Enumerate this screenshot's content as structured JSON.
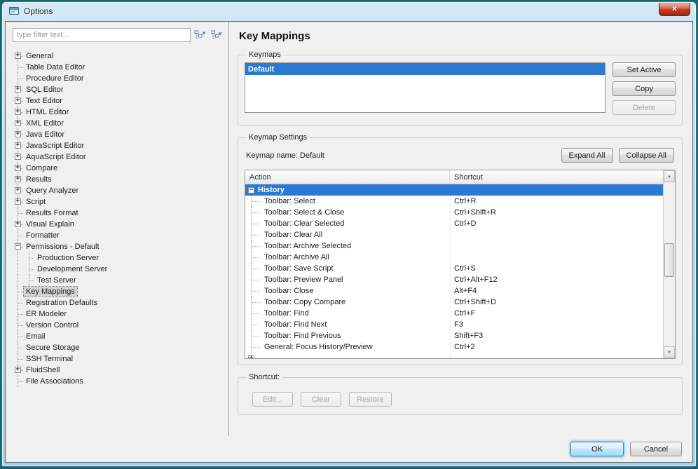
{
  "window": {
    "title": "Options"
  },
  "icons": {
    "close": "✕",
    "plus": "+",
    "minus": "−",
    "scroll_up": "▲",
    "scroll_down": "▼"
  },
  "sidebar": {
    "filter_placeholder": "type filter text...",
    "tree": [
      {
        "label": "General",
        "expander": "plus",
        "level": 0
      },
      {
        "label": "Table Data Editor",
        "expander": "none",
        "level": 0
      },
      {
        "label": "Procedure Editor",
        "expander": "none",
        "level": 0
      },
      {
        "label": "SQL Editor",
        "expander": "plus",
        "level": 0
      },
      {
        "label": "Text Editor",
        "expander": "plus",
        "level": 0
      },
      {
        "label": "HTML Editor",
        "expander": "plus",
        "level": 0
      },
      {
        "label": "XML Editor",
        "expander": "plus",
        "level": 0
      },
      {
        "label": "Java Editor",
        "expander": "plus",
        "level": 0
      },
      {
        "label": "JavaScript Editor",
        "expander": "plus",
        "level": 0
      },
      {
        "label": "AquaScript Editor",
        "expander": "plus",
        "level": 0
      },
      {
        "label": "Compare",
        "expander": "plus",
        "level": 0
      },
      {
        "label": "Results",
        "expander": "plus",
        "level": 0
      },
      {
        "label": "Query Analyzer",
        "expander": "plus",
        "level": 0
      },
      {
        "label": "Script",
        "expander": "plus",
        "level": 0
      },
      {
        "label": "Results Format",
        "expander": "none",
        "level": 0
      },
      {
        "label": "Visual Explain",
        "expander": "plus",
        "level": 0
      },
      {
        "label": "Formatter",
        "expander": "none",
        "level": 0
      },
      {
        "label": "Permissions - Default",
        "expander": "minus",
        "level": 0
      },
      {
        "label": "Production Server",
        "expander": "none",
        "level": 1
      },
      {
        "label": "Development Server",
        "expander": "none",
        "level": 1
      },
      {
        "label": "Test Server",
        "expander": "none",
        "level": 1
      },
      {
        "label": "Key Mappings",
        "expander": "none",
        "level": 0,
        "selected": true
      },
      {
        "label": "Registration Defaults",
        "expander": "none",
        "level": 0
      },
      {
        "label": "ER Modeler",
        "expander": "none",
        "level": 0
      },
      {
        "label": "Version Control",
        "expander": "none",
        "level": 0
      },
      {
        "label": "Email",
        "expander": "none",
        "level": 0
      },
      {
        "label": "Secure Storage",
        "expander": "none",
        "level": 0
      },
      {
        "label": "SSH Terminal",
        "expander": "none",
        "level": 0
      },
      {
        "label": "FluidShell",
        "expander": "plus",
        "level": 0
      },
      {
        "label": "File Associations",
        "expander": "none",
        "level": 0
      }
    ]
  },
  "main": {
    "title": "Key Mappings",
    "keymaps": {
      "legend": "Keymaps",
      "items": [
        {
          "label": "Default",
          "selected": true
        }
      ],
      "buttons": {
        "set_active": "Set Active",
        "copy": "Copy",
        "delete": "Delete"
      }
    },
    "settings": {
      "legend": "Keymap Settings",
      "keymap_name": "Keymap name: Default",
      "expand_all": "Expand All",
      "collapse_all": "Collapse All",
      "table": {
        "columns": [
          "Action",
          "Shortcut"
        ],
        "rows": [
          {
            "action": "History",
            "shortcut": "",
            "type": "group",
            "expander": "minus",
            "selected": true
          },
          {
            "action": "Toolbar: Select",
            "shortcut": "Ctrl+R"
          },
          {
            "action": "Toolbar: Select & Close",
            "shortcut": "Ctrl+Shift+R"
          },
          {
            "action": "Toolbar: Clear Selected",
            "shortcut": "Ctrl+D"
          },
          {
            "action": "Toolbar: Clear All",
            "shortcut": ""
          },
          {
            "action": "Toolbar: Archive Selected",
            "shortcut": ""
          },
          {
            "action": "Toolbar: Archive All",
            "shortcut": ""
          },
          {
            "action": "Toolbar: Save Script",
            "shortcut": "Ctrl+S"
          },
          {
            "action": "Toolbar: Preview Panel",
            "shortcut": "Ctrl+Alt+F12"
          },
          {
            "action": "Toolbar: Close",
            "shortcut": "Alt+F4"
          },
          {
            "action": "Toolbar: Copy Compare",
            "shortcut": "Ctrl+Shift+D"
          },
          {
            "action": "Toolbar: Find",
            "shortcut": "Ctrl+F"
          },
          {
            "action": "Toolbar: Find Next",
            "shortcut": "F3"
          },
          {
            "action": "Toolbar: Find Previous",
            "shortcut": "Shift+F3"
          },
          {
            "action": "General: Focus History/Preview",
            "shortcut": "Ctrl+2"
          },
          {
            "action": "",
            "shortcut": "",
            "type": "group",
            "expander": "plus"
          }
        ]
      }
    },
    "shortcut": {
      "legend": "Shortcut:",
      "buttons": {
        "edit": "Edit...",
        "clear": "Clear",
        "restore": "Restore"
      }
    },
    "footer": {
      "ok": "OK",
      "cancel": "Cancel"
    }
  }
}
